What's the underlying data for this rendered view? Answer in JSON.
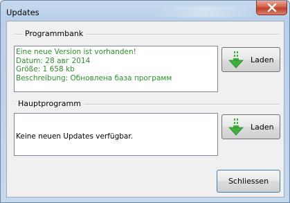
{
  "window": {
    "title": "Updates"
  },
  "program_bank": {
    "group_label": "Programmbank",
    "lines": [
      "Eine neue Version ist vorhanden!",
      "Datum: 28 авг 2014",
      "Größe: 1 658 kb",
      "Beschreibung: Обновлена база программ"
    ],
    "load_button": "Laden"
  },
  "main_program": {
    "group_label": "Hauptprogramm",
    "text": "Keine neuen Updates verfügbar.",
    "load_button": "Laden"
  },
  "close_button": "Schliessen",
  "colors": {
    "green_text": "#2d8f2d",
    "arrow_green": "#3fae3f",
    "close_red": "#c0412c"
  },
  "icons": [
    "close-icon",
    "download-arrow-icon"
  ]
}
